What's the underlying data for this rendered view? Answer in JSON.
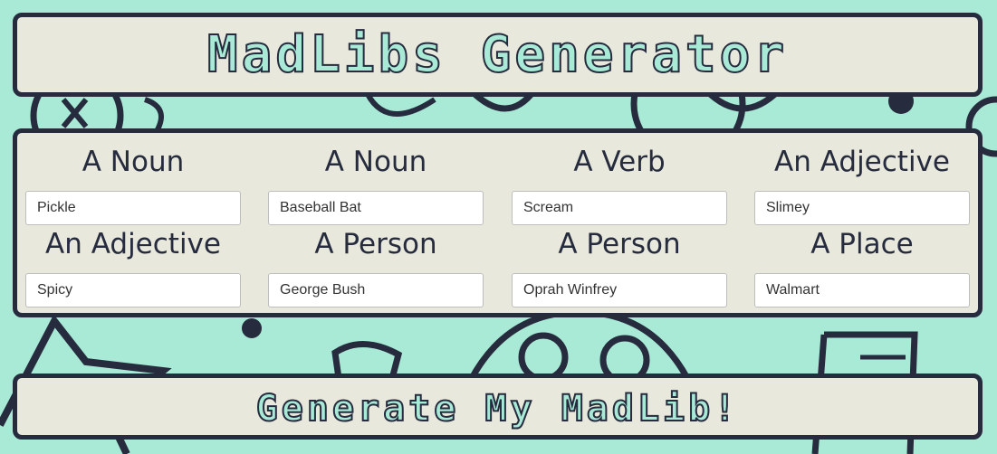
{
  "title": "MadLibs Generator",
  "fields": [
    {
      "label": "A Noun",
      "value": "Pickle"
    },
    {
      "label": "A Noun",
      "value": "Baseball Bat"
    },
    {
      "label": "A Verb",
      "value": "Scream"
    },
    {
      "label": "An Adjective",
      "value": "Slimey"
    },
    {
      "label": "An Adjective",
      "value": "Spicy"
    },
    {
      "label": "A Person",
      "value": "George Bush"
    },
    {
      "label": "A Person",
      "value": "Oprah Winfrey"
    },
    {
      "label": "A Place",
      "value": "Walmart"
    }
  ],
  "generate_button": {
    "label": "Generate My MadLib!"
  },
  "colors": {
    "background": "#a8ead6",
    "panel": "#e8e9dc",
    "border": "#262b3e"
  }
}
